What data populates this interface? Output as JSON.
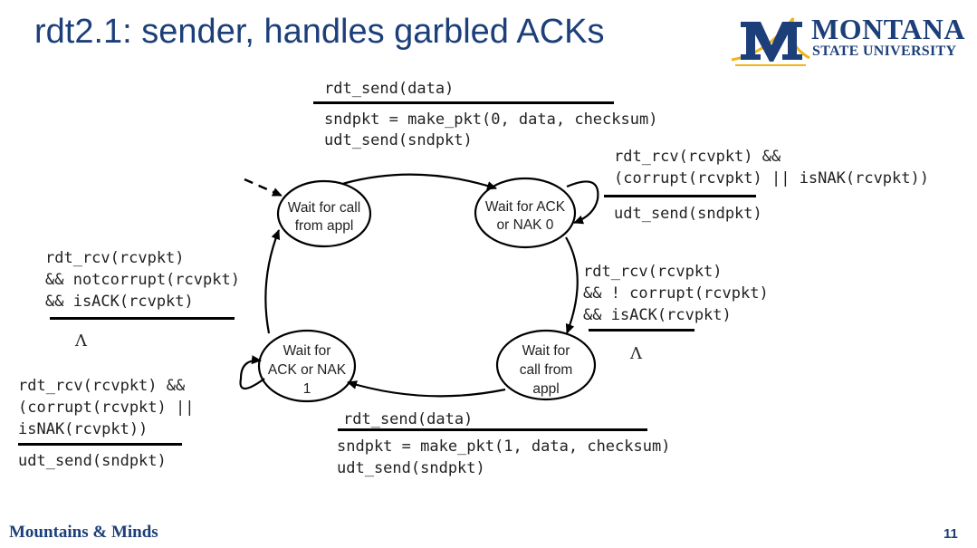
{
  "slide": {
    "title": "rdt2.1: sender, handles garbled ACKs",
    "footer": "Mountains & Minds",
    "page_number": "11"
  },
  "logo": {
    "line1": "MONTANA",
    "line2": "STATE UNIVERSITY",
    "colors": {
      "navy": "#1c3f7a",
      "gold": "#f2b418"
    }
  },
  "states": [
    {
      "id": "wait-call-0",
      "lines": [
        "Wait for call",
        "from appl"
      ]
    },
    {
      "id": "wait-ack-0",
      "lines": [
        "Wait for ACK",
        "or NAK 0"
      ]
    },
    {
      "id": "wait-call-1",
      "lines": [
        "Wait for",
        "call from",
        "appl"
      ]
    },
    {
      "id": "wait-ack-1",
      "lines": [
        "Wait for",
        "ACK or NAK",
        "1"
      ]
    }
  ],
  "transitions": {
    "t1": {
      "event": "rdt_send(data)",
      "actions": [
        "sndpkt = make_pkt(0, data, checksum)",
        "udt_send(sndpkt)"
      ]
    },
    "t2": {
      "events": [
        "rdt_rcv(rcvpkt) &&",
        "(corrupt(rcvpkt) || isNAK(rcvpkt))"
      ],
      "action": "udt_send(sndpkt)"
    },
    "t3": {
      "events": [
        "rdt_rcv(rcvpkt)",
        "&& ! corrupt(rcvpkt)",
        "&& isACK(rcvpkt)"
      ],
      "action": "Λ"
    },
    "t4": {
      "event": "rdt_send(data)",
      "actions": [
        "sndpkt = make_pkt(1, data, checksum)",
        "udt_send(sndpkt)"
      ]
    },
    "t5": {
      "events": [
        "rdt_rcv(rcvpkt) &&",
        "(corrupt(rcvpkt) ||",
        "isNAK(rcvpkt))"
      ],
      "action": "udt_send(sndpkt)"
    },
    "t6": {
      "events": [
        "rdt_rcv(rcvpkt)",
        "&& notcorrupt(rcvpkt)",
        "&& isACK(rcvpkt)"
      ],
      "action": "Λ"
    }
  }
}
